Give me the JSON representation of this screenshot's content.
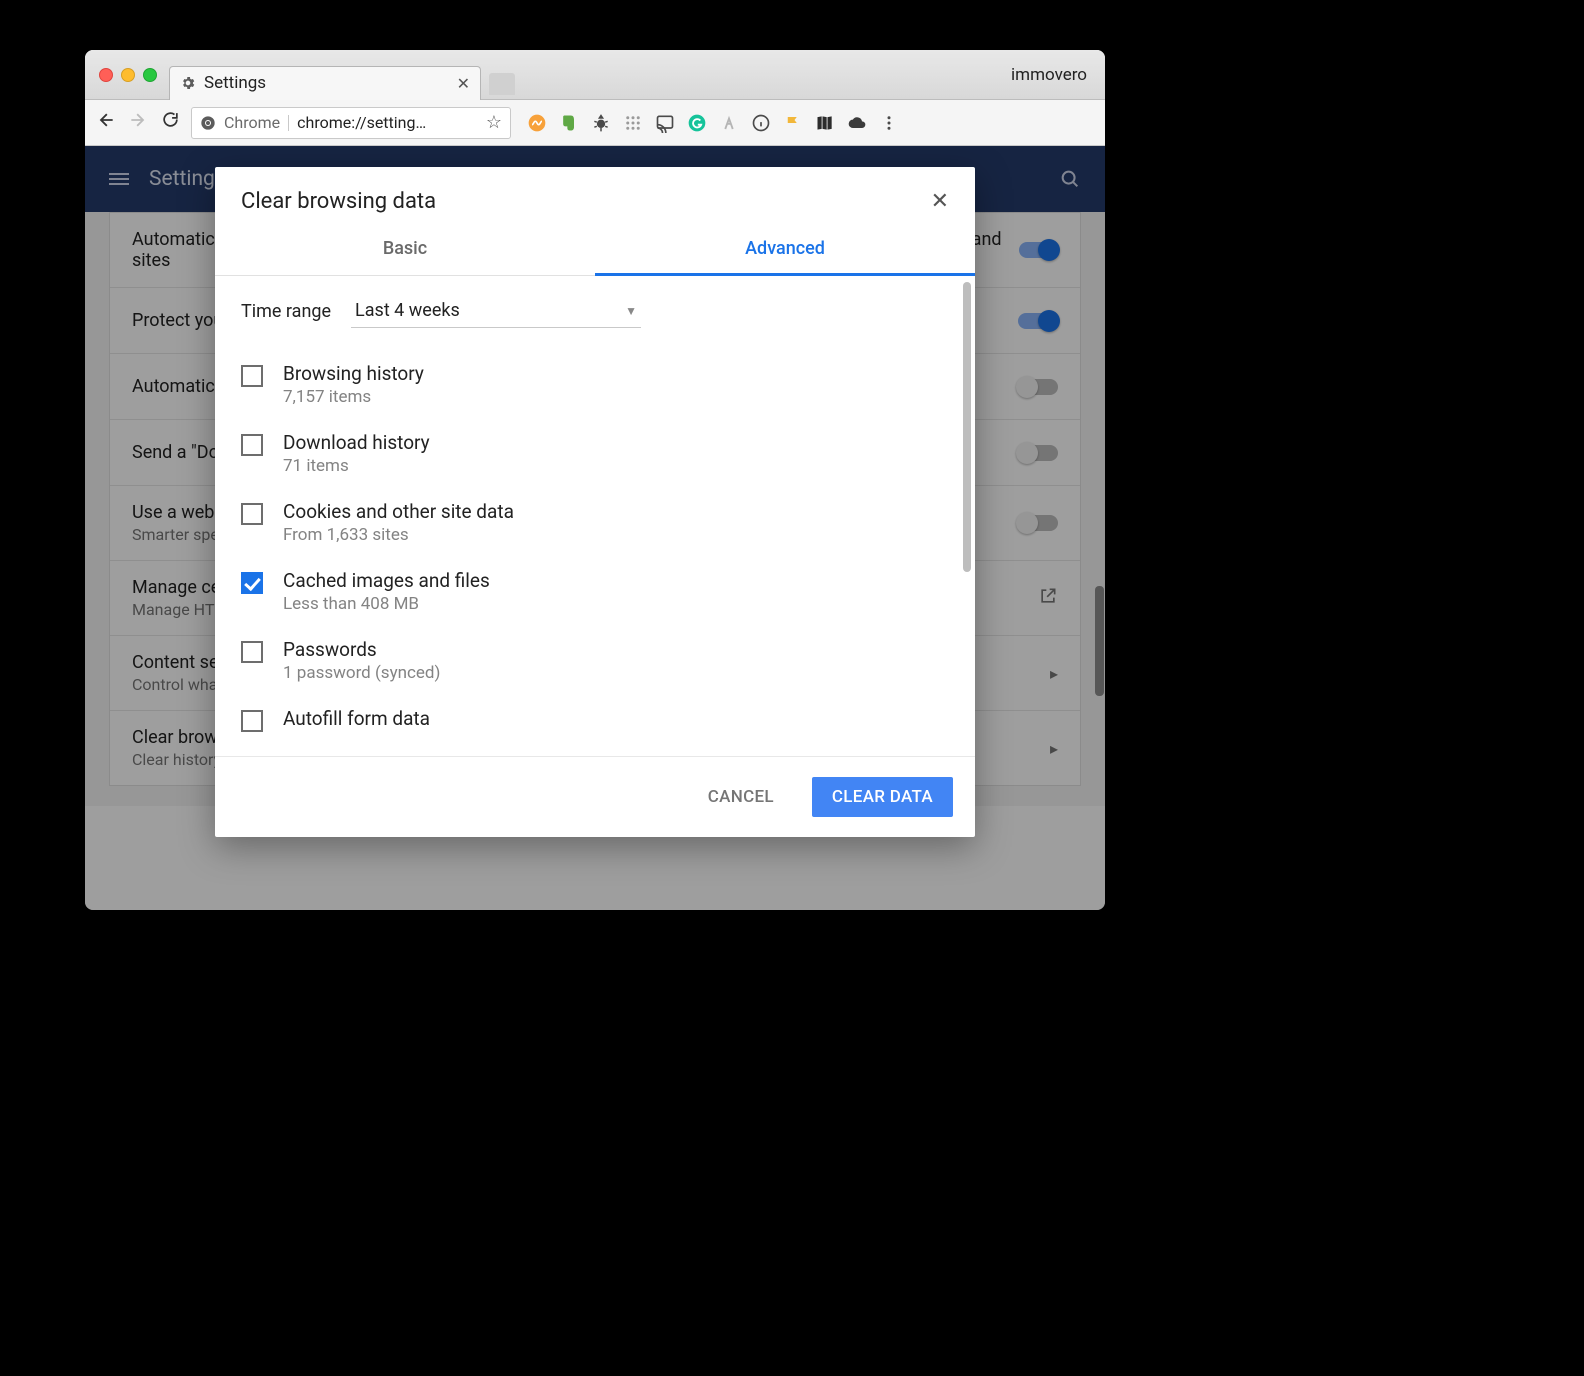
{
  "browser": {
    "tab_title": "Settings",
    "profile_name": "immovero",
    "omnibox_prefix": "Chrome",
    "omnibox_url": "chrome://setting…"
  },
  "settings": {
    "page_title": "Settings",
    "rows": [
      {
        "primary": "Automatically send some system information and page content to Google to help detect dangerous apps and sites",
        "secondary": "",
        "control": "toggle-on"
      },
      {
        "primary": "Protect you and your device from dangerous sites",
        "secondary": "",
        "control": "toggle-on"
      },
      {
        "primary": "Automatically send usage statistics and crash reports to Google",
        "secondary": "",
        "control": "toggle-off"
      },
      {
        "primary": "Send a \"Do Not Track\" request with your browsing traffic",
        "secondary": "",
        "control": "toggle-off"
      },
      {
        "primary": "Use a web service to help resolve spelling errors",
        "secondary": "Smarter spell-checking by sending what you type in the browser to Google",
        "control": "toggle-off"
      },
      {
        "primary": "Manage certificates",
        "secondary": "Manage HTTPS/SSL certificates and settings",
        "control": "ext-link"
      },
      {
        "primary": "Content settings",
        "secondary": "Control what information websites can use and what content they can show you",
        "control": "chevron"
      },
      {
        "primary": "Clear browsing data",
        "secondary": "Clear history, cookies, cache, and more",
        "control": "chevron"
      }
    ]
  },
  "dialog": {
    "title": "Clear browsing data",
    "tab_basic": "Basic",
    "tab_advanced": "Advanced",
    "time_range_label": "Time range",
    "time_range_value": "Last 4 weeks",
    "options": [
      {
        "label": "Browsing history",
        "sub": "7,157 items",
        "checked": false
      },
      {
        "label": "Download history",
        "sub": "71 items",
        "checked": false
      },
      {
        "label": "Cookies and other site data",
        "sub": "From 1,633 sites",
        "checked": false
      },
      {
        "label": "Cached images and files",
        "sub": "Less than 408 MB",
        "checked": true
      },
      {
        "label": "Passwords",
        "sub": "1 password (synced)",
        "checked": false
      },
      {
        "label": "Autofill form data",
        "sub": "",
        "checked": false
      }
    ],
    "cancel_label": "CANCEL",
    "confirm_label": "CLEAR DATA"
  }
}
